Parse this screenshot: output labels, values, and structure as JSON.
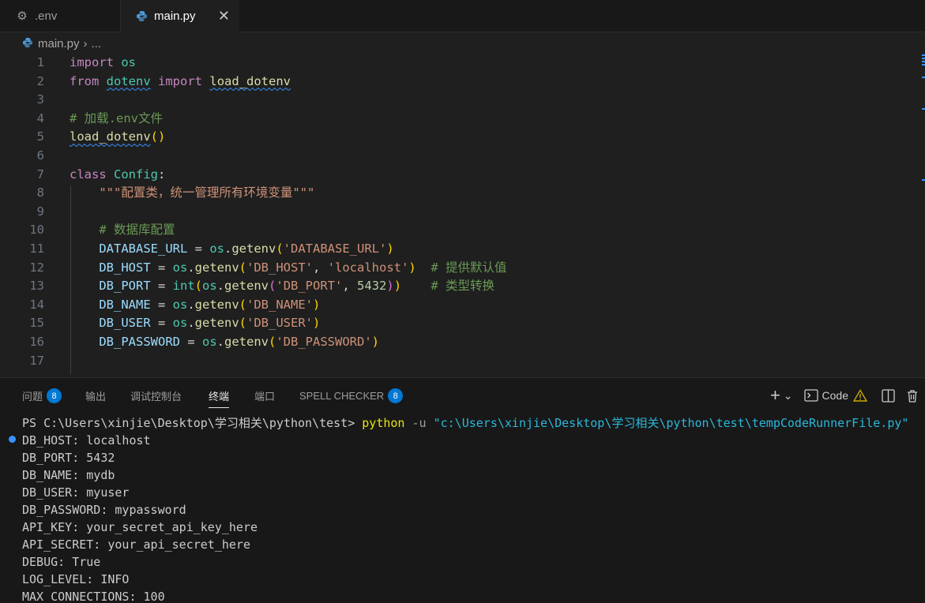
{
  "tabs": [
    {
      "label": ".env",
      "icon": "gear-icon"
    },
    {
      "label": "main.py",
      "icon": "python-icon",
      "close": "✕"
    }
  ],
  "breadcrumb": {
    "file": "main.py",
    "separator": "›",
    "rest": "..."
  },
  "editor": {
    "line_numbers": [
      "1",
      "2",
      "3",
      "4",
      "5",
      "6",
      "7",
      "8",
      "9",
      "10",
      "11",
      "12",
      "13",
      "14",
      "15",
      "16",
      "17"
    ],
    "lines": [
      [
        [
          "kw",
          "import"
        ],
        [
          "plain",
          " "
        ],
        [
          "mod",
          "os"
        ]
      ],
      [
        [
          "kw",
          "from"
        ],
        [
          "plain",
          " "
        ],
        [
          "mod_sq",
          "dotenv"
        ],
        [
          "plain",
          " "
        ],
        [
          "kw",
          "import"
        ],
        [
          "plain",
          " "
        ],
        [
          "fn_sq",
          "load_dotenv"
        ]
      ],
      [],
      [
        [
          "com",
          "# 加载.env文件"
        ]
      ],
      [
        [
          "fn_sq",
          "load_dotenv"
        ],
        [
          "p1",
          "()"
        ]
      ],
      [],
      [
        [
          "kw",
          "class"
        ],
        [
          "plain",
          " "
        ],
        [
          "cls",
          "Config"
        ],
        [
          "plain",
          ":"
        ]
      ],
      [
        [
          "plain",
          "    "
        ],
        [
          "str",
          "\"\"\"配置类，统一管理所有环境变量\"\"\""
        ]
      ],
      [],
      [
        [
          "plain",
          "    "
        ],
        [
          "com",
          "# 数据库配置"
        ]
      ],
      [
        [
          "plain",
          "    "
        ],
        [
          "ident",
          "DATABASE_URL"
        ],
        [
          "plain",
          " = "
        ],
        [
          "mod",
          "os"
        ],
        [
          "plain",
          "."
        ],
        [
          "fn",
          "getenv"
        ],
        [
          "p1",
          "("
        ],
        [
          "str",
          "'DATABASE_URL'"
        ],
        [
          "p1",
          ")"
        ]
      ],
      [
        [
          "plain",
          "    "
        ],
        [
          "ident",
          "DB_HOST"
        ],
        [
          "plain",
          " = "
        ],
        [
          "mod",
          "os"
        ],
        [
          "plain",
          "."
        ],
        [
          "fn",
          "getenv"
        ],
        [
          "p1",
          "("
        ],
        [
          "str",
          "'DB_HOST'"
        ],
        [
          "plain",
          ", "
        ],
        [
          "str",
          "'localhost'"
        ],
        [
          "p1",
          ")"
        ],
        [
          "plain",
          "  "
        ],
        [
          "com",
          "# 提供默认值"
        ]
      ],
      [
        [
          "plain",
          "    "
        ],
        [
          "ident",
          "DB_PORT"
        ],
        [
          "plain",
          " = "
        ],
        [
          "cls",
          "int"
        ],
        [
          "p1",
          "("
        ],
        [
          "mod",
          "os"
        ],
        [
          "plain",
          "."
        ],
        [
          "fn",
          "getenv"
        ],
        [
          "p2",
          "("
        ],
        [
          "str",
          "'DB_PORT'"
        ],
        [
          "plain",
          ", "
        ],
        [
          "num",
          "5432"
        ],
        [
          "p2",
          ")"
        ],
        [
          "p1",
          ")"
        ],
        [
          "plain",
          "    "
        ],
        [
          "com",
          "# 类型转换"
        ]
      ],
      [
        [
          "plain",
          "    "
        ],
        [
          "ident",
          "DB_NAME"
        ],
        [
          "plain",
          " = "
        ],
        [
          "mod",
          "os"
        ],
        [
          "plain",
          "."
        ],
        [
          "fn",
          "getenv"
        ],
        [
          "p1",
          "("
        ],
        [
          "str",
          "'DB_NAME'"
        ],
        [
          "p1",
          ")"
        ]
      ],
      [
        [
          "plain",
          "    "
        ],
        [
          "ident",
          "DB_USER"
        ],
        [
          "plain",
          " = "
        ],
        [
          "mod",
          "os"
        ],
        [
          "plain",
          "."
        ],
        [
          "fn",
          "getenv"
        ],
        [
          "p1",
          "("
        ],
        [
          "str",
          "'DB_USER'"
        ],
        [
          "p1",
          ")"
        ]
      ],
      [
        [
          "plain",
          "    "
        ],
        [
          "ident",
          "DB_PASSWORD"
        ],
        [
          "plain",
          " = "
        ],
        [
          "mod",
          "os"
        ],
        [
          "plain",
          "."
        ],
        [
          "fn",
          "getenv"
        ],
        [
          "p1",
          "("
        ],
        [
          "str",
          "'DB_PASSWORD'"
        ],
        [
          "p1",
          ")"
        ]
      ],
      []
    ]
  },
  "panel": {
    "tabs": [
      {
        "label": "问题",
        "badge": "8"
      },
      {
        "label": "输出"
      },
      {
        "label": "调试控制台"
      },
      {
        "label": "终端",
        "active": true
      },
      {
        "label": "端口"
      },
      {
        "label": "SPELL CHECKER",
        "badge": "8"
      }
    ],
    "actions": {
      "add": "+",
      "dropdown": "⌄",
      "code_label": "Code"
    }
  },
  "terminal": {
    "prompt": "PS C:\\Users\\xinjie\\Desktop\\学习相关\\python\\test> ",
    "command": "python",
    "flag": " -u ",
    "path": "\"c:\\Users\\xinjie\\Desktop\\学习相关\\python\\test\\tempCodeRunnerFile.py\"",
    "output": [
      "DB_HOST: localhost",
      "DB_PORT: 5432",
      "DB_NAME: mydb",
      "DB_USER: myuser",
      "DB_PASSWORD: mypassword",
      "API_KEY: your_secret_api_key_here",
      "API_SECRET: your_api_secret_here",
      "DEBUG: True",
      "LOG_LEVEL: INFO",
      "MAX_CONNECTIONS: 100"
    ]
  }
}
